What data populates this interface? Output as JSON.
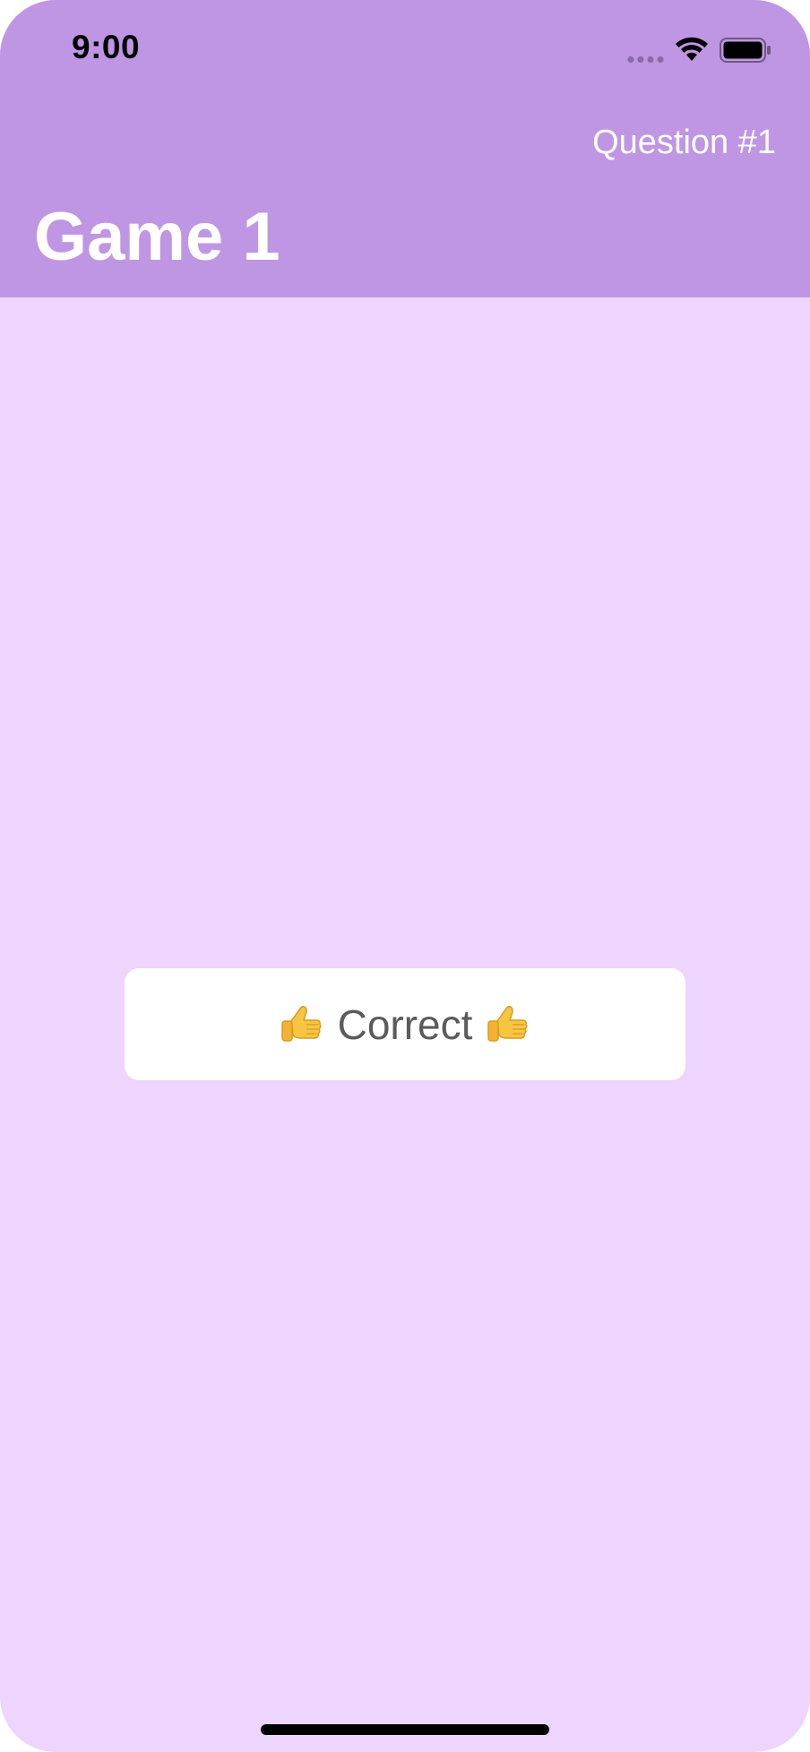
{
  "status_bar": {
    "time": "9:00"
  },
  "nav": {
    "title": "Game 1",
    "right_item": "Question #1"
  },
  "result": {
    "label": "Correct",
    "leading_icon": "thumbs-up-icon",
    "trailing_icon": "thumbs-up-icon"
  },
  "colors": {
    "header_background": "#BF96E3",
    "page_background": "#EED5FD",
    "card_background": "#FFFFFF",
    "card_text": "#5B5B5B"
  }
}
